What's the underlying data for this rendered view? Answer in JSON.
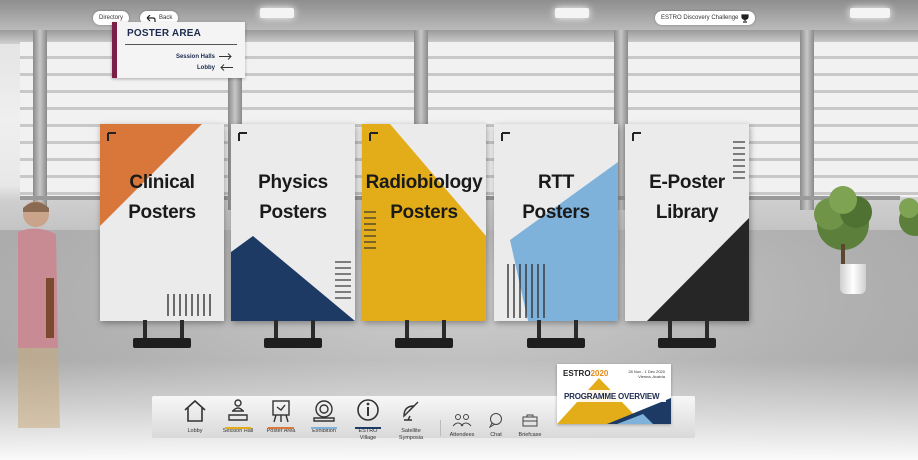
{
  "top_nav": {
    "directory_label": "Directory",
    "back_label": "Back",
    "challenge_label": "ESTRO Discovery Challenge"
  },
  "sign": {
    "title": "POSTER AREA",
    "session_halls": "Session Halls",
    "lobby": "Lobby"
  },
  "posters": [
    {
      "line1": "Clinical",
      "line2": "Posters",
      "accent": "#d9773a"
    },
    {
      "line1": "Physics",
      "line2": "Posters",
      "accent": "#1c3a64"
    },
    {
      "line1": "Radiobiology",
      "line2": "Posters",
      "accent": "#e3ad1a"
    },
    {
      "line1": "RTT",
      "line2": "Posters",
      "accent": "#7fb2da"
    },
    {
      "line1": "E-Poster",
      "line2": "Library",
      "accent": "#262626"
    }
  ],
  "toolbar": {
    "items": [
      {
        "label": "Lobby",
        "icon": "house-icon"
      },
      {
        "label": "Session Hall",
        "icon": "presenter-icon"
      },
      {
        "label": "Poster Area",
        "icon": "easel-icon"
      },
      {
        "label": "Exhibition",
        "icon": "scanner-icon"
      },
      {
        "label1": "ESTRO",
        "label2": "Village",
        "icon": "info-icon"
      },
      {
        "label1": "Satellite",
        "label2": "Symposia",
        "icon": "satellite-icon"
      }
    ],
    "secondary": [
      {
        "label": "Attendees",
        "icon": "people-icon"
      },
      {
        "label": "Chat",
        "icon": "chat-icon"
      },
      {
        "label": "Briefcase",
        "icon": "briefcase-icon"
      }
    ],
    "underline_colors": [
      "#e3ad1a",
      "#d9773a",
      "#7fb2da",
      "#1c3a64"
    ]
  },
  "programme": {
    "logo_a": "ESTRO",
    "logo_b": "2020",
    "date_line1": "28 Nov - 1 Dec 2020",
    "date_line2": "Vienna, Austria",
    "title": "PROGRAMME OVERVIEW"
  }
}
